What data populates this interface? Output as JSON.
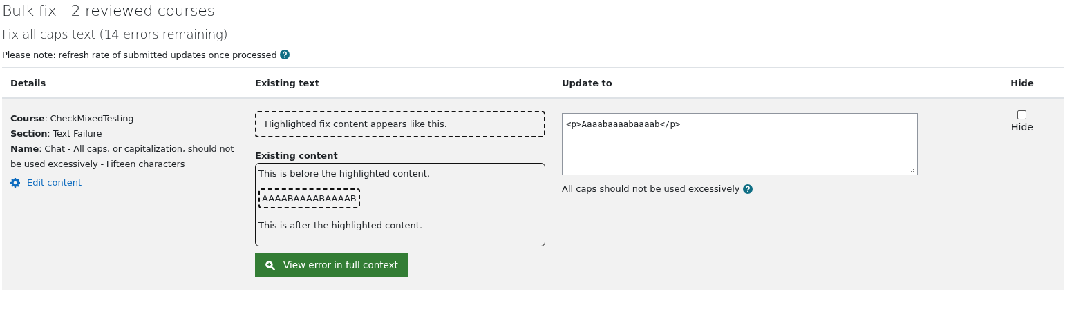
{
  "page_title": "Bulk fix - 2 reviewed courses",
  "subtitle": "Fix all caps text (14 errors remaining)",
  "note": "Please note: refresh rate of submitted updates once processed",
  "table": {
    "columns": [
      "Details",
      "Existing text",
      "Update to",
      "Hide"
    ],
    "rows": [
      {
        "details": [
          "**Course**: CheckMixedTesting",
          "**Section**: Text Failure",
          "**Name**: Chat - All caps, or capitalization, should not be used excessively - Fifteen characters"
        ],
        "edit_link": "Edit content",
        "highlight_sample": "Highlighted fix content appears like this.",
        "existing_content_label": "Existing content",
        "before": "This is before the highlighted content.",
        "highlighted": "AAAABAAAABAAAAB",
        "after": "This is after the highlighted content.",
        "view_button": "View error in full context",
        "update_value": "<p>Aaaabaaaabaaaab</p>",
        "update_hint": "All caps should not be used excessively",
        "hide": {
          "label": "Hide",
          "checked": false
        }
      }
    ]
  }
}
